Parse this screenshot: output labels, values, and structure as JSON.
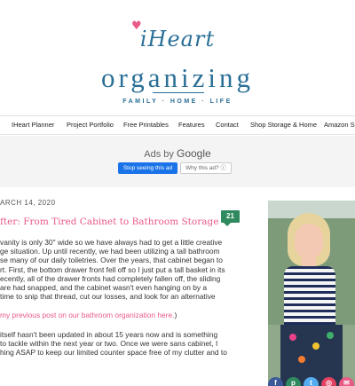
{
  "logo": {
    "iheart": "iHeart",
    "main": "organizing",
    "tagline": "FAMILY · HOME · LIFE"
  },
  "nav": {
    "items": [
      "IHeart Planner",
      "Project Portfolio",
      "Free Printables",
      "Features",
      "Contact",
      "Shop Storage & Home",
      "Amazon S"
    ]
  },
  "ad": {
    "label_prefix": "Ads by ",
    "label_brand": "Google",
    "stop_button": "Stop seeing this ad",
    "why_button": "Why this ad? ⓘ"
  },
  "post": {
    "date": "ARCH 14, 2020",
    "title": "fter: From Tired Cabinet to Bathroom Storage",
    "comment_count": "21",
    "paragraph1": [
      "vanity is only 30\" wide so we have always had to get a little creative",
      "ge situation. Up until recently, we had been utilizing a tall bathroom",
      "se many of our daily toiletries. Over the years, that cabinet began to",
      "rt. First, the bottom drawer front fell off so I just put a tall basket in its",
      "ecently, all of the drawer fronts had completely fallen off, the sliding",
      "are had snapped, and the cabinet wasn't even hanging on by a",
      "time to snip that thread, cut our losses, and look for an alternative"
    ],
    "link_line": "my previous post on our bathroom organization here.",
    "link_suffix": ")",
    "paragraph2": [
      "itself hasn't been updated in about 15 years now and is something",
      "to tackle within the next year or two. Once we were sans cabinet, I",
      "hing ASAP to keep our limited counter space free of my clutter and to"
    ]
  },
  "sidebar": {
    "social_icons": [
      "facebook-icon",
      "pinterest-icon",
      "twitter-icon",
      "instagram-icon",
      "email-icon"
    ]
  },
  "colors": {
    "brand_blue": "#2a6f97",
    "accent_pink": "#e85a86",
    "comment_green": "#2f8a5f",
    "ad_blue": "#1a73e8"
  }
}
